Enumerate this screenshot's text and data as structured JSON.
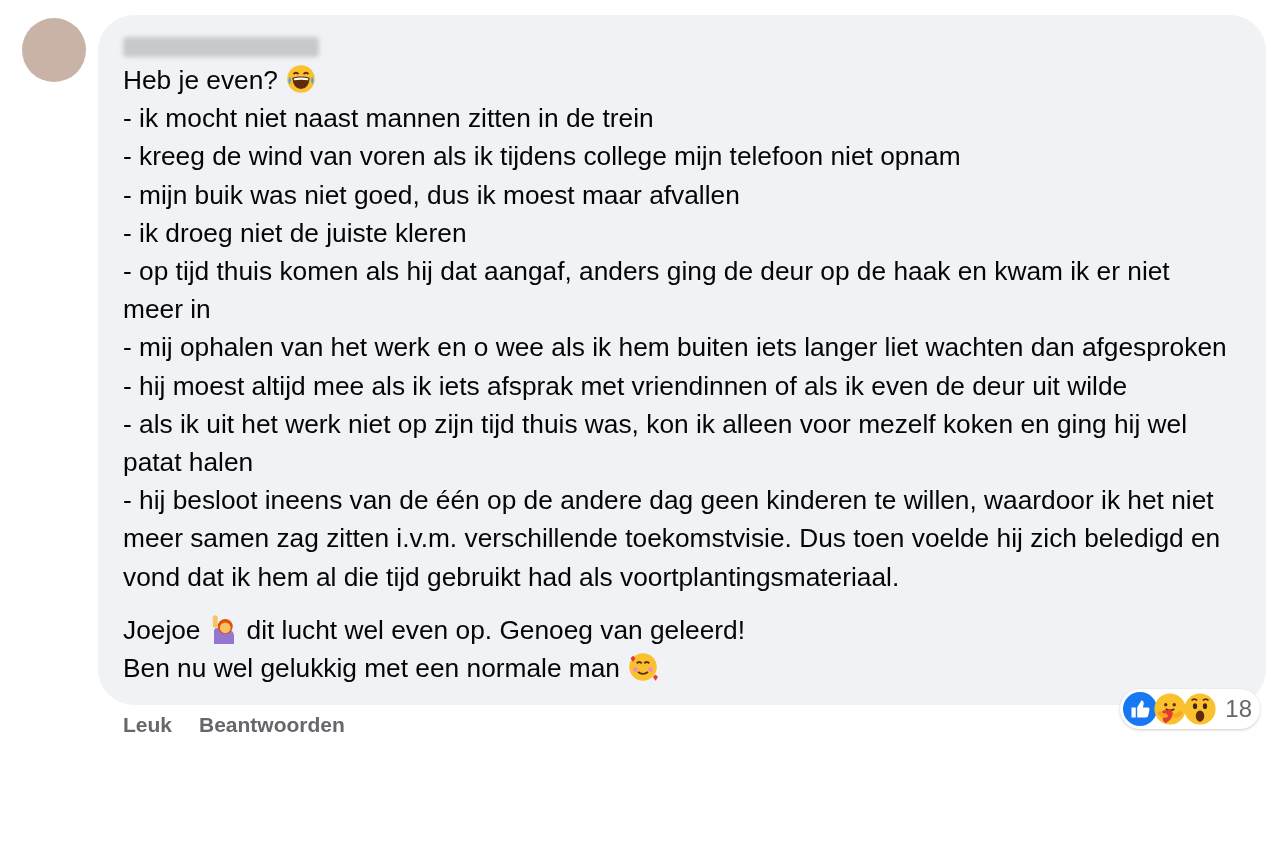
{
  "comment": {
    "paragraphs": [
      [
        [
          {
            "kind": "text",
            "text": "Heb je even?"
          },
          {
            "kind": "laugh"
          }
        ],
        [
          {
            "kind": "text",
            "text": "- ik mocht niet naast mannen zitten in de trein"
          }
        ],
        [
          {
            "kind": "text",
            "text": "- kreeg de wind van voren als ik tijdens college mijn telefoon niet opnam"
          }
        ],
        [
          {
            "kind": "text",
            "text": "- mijn buik was niet goed, dus ik moest maar afvallen"
          }
        ],
        [
          {
            "kind": "text",
            "text": "- ik droeg niet de juiste kleren"
          }
        ],
        [
          {
            "kind": "text",
            "text": "- op tijd thuis komen als hij dat aangaf, anders ging de deur op de haak en kwam ik er niet meer in"
          }
        ],
        [
          {
            "kind": "text",
            "text": "- mij ophalen van het werk en o wee als ik hem buiten iets langer liet wachten dan afgesproken"
          }
        ],
        [
          {
            "kind": "text",
            "text": "- hij moest altijd mee als ik iets afsprak met vriendinnen of als ik even de deur uit wilde"
          }
        ],
        [
          {
            "kind": "text",
            "text": "- als ik uit het werk niet op zijn tijd thuis was, kon ik alleen voor mezelf koken en ging hij wel patat halen"
          }
        ],
        [
          {
            "kind": "text",
            "text": "- hij besloot ineens van de één op de andere dag geen kinderen te willen, waardoor ik het niet meer samen zag zitten i.v.m. verschillende toekomstvisie. Dus toen voelde hij zich beledigd en vond dat ik hem al die tijd gebruikt had als voortplantingsmateriaal."
          }
        ]
      ],
      [
        [
          {
            "kind": "text",
            "text": "Joejoe"
          },
          {
            "kind": "wave"
          },
          {
            "kind": "text",
            "text": "dit lucht wel even op. Genoeg van geleerd!"
          }
        ],
        [
          {
            "kind": "text",
            "text": "Ben nu wel gelukkig met een normale man"
          },
          {
            "kind": "love"
          }
        ]
      ]
    ],
    "reactions": {
      "faces": [
        {
          "kind": "like"
        },
        {
          "kind": "care"
        },
        {
          "kind": "wow"
        }
      ],
      "count": "18"
    },
    "actions": [
      "Leuk",
      "Beantwoorden"
    ]
  }
}
